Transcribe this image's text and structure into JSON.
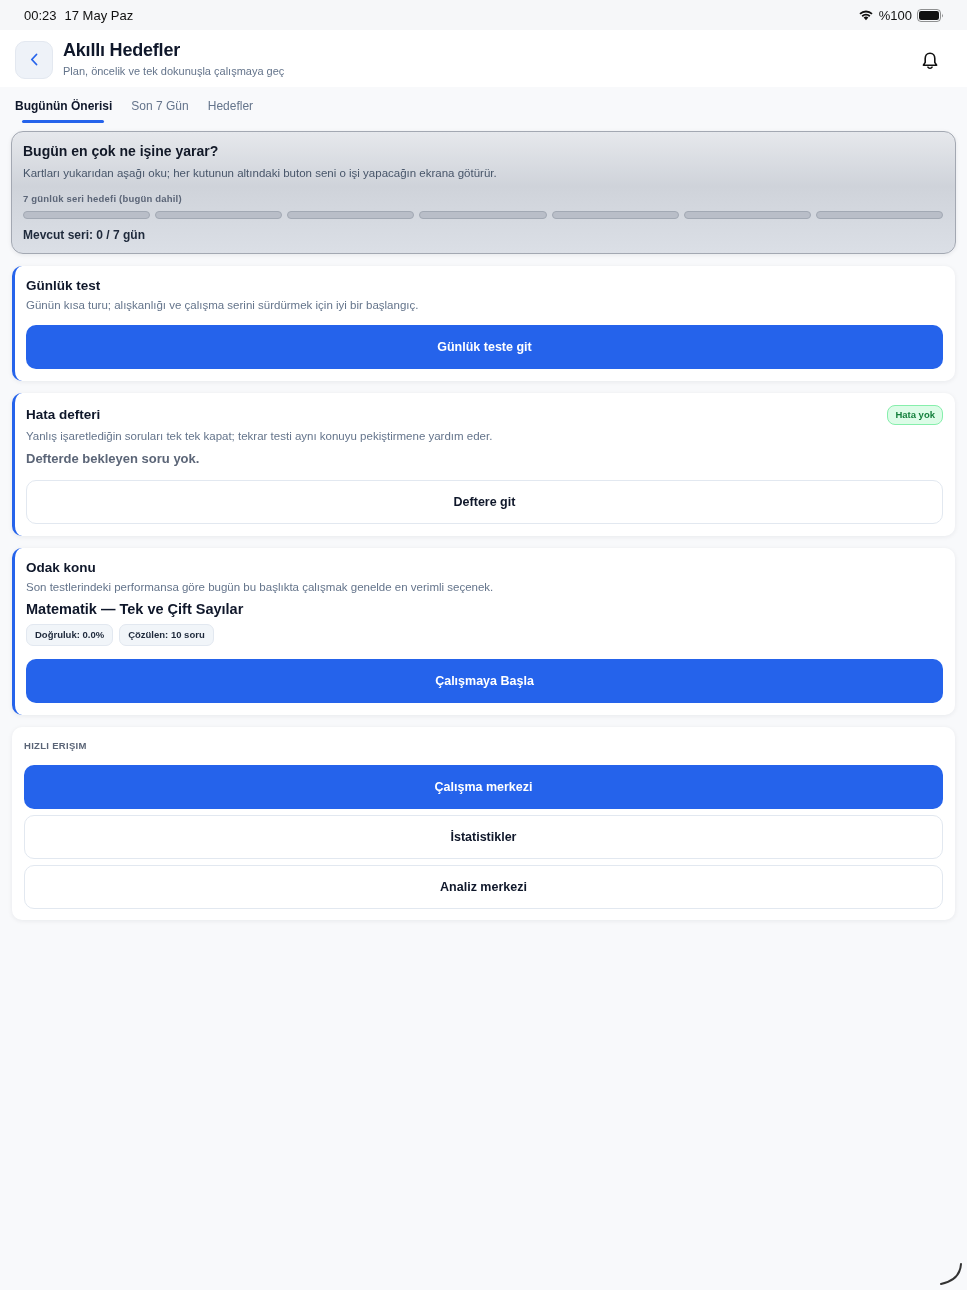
{
  "status_bar": {
    "time": "00:23",
    "date": "17 May Paz",
    "battery": "%100"
  },
  "header": {
    "title": "Akıllı Hedefler",
    "subtitle": "Plan, öncelik ve tek dokunuşla çalışmaya geç"
  },
  "tabs": [
    {
      "label": "Bugünün Önerisi",
      "selected": true
    },
    {
      "label": "Son 7 Gün",
      "selected": false
    },
    {
      "label": "Hedefler",
      "selected": false
    }
  ],
  "hero": {
    "title": "Bugün en çok ne işine yarar?",
    "text": "Kartları yukarıdan aşağı oku; her kutunun altındaki buton seni o işi yapacağın ekrana götürür.",
    "streak_label": "7 günlük seri hedefi (bugün dahil)",
    "streak_days": [
      {
        "done": false
      },
      {
        "done": false
      },
      {
        "done": false
      },
      {
        "done": false
      },
      {
        "done": false
      },
      {
        "done": false
      },
      {
        "done": false
      }
    ],
    "streak_text": "Mevcut seri: 0 / 7 gün"
  },
  "cards": [
    {
      "title": "Günlük test",
      "text": "Günün kısa turu; alışkanlığı ve çalışma serini sürdürmek için iyi bir başlangıç.",
      "button": {
        "label": "Günlük teste git",
        "kind": "primary"
      }
    },
    {
      "title": "Hata defteri",
      "badge": "Hata yok",
      "text": "Yanlış işaretlediğin soruları tek tek kapat; tekrar testi aynı konuyu pekiştirmene yardım eder.",
      "note": "Defterde bekleyen soru yok.",
      "button": {
        "label": "Deftere git",
        "kind": "secondary"
      }
    },
    {
      "title": "Odak konu",
      "text": "Son testlerindeki performansa göre bugün bu başlıkta çalışmak genelde en verimli seçenek.",
      "topic": "Matematik — Tek ve Çift Sayılar",
      "chips": [
        "Doğruluk: 0.0%",
        "Çözülen: 10 soru"
      ],
      "button": {
        "label": "Çalışmaya Başla",
        "kind": "primary"
      }
    }
  ],
  "quick_access": {
    "heading": "HIZLI ERIŞIM",
    "buttons": [
      {
        "label": "Çalışma merkezi",
        "kind": "primary"
      },
      {
        "label": "İstatistikler",
        "kind": "secondary"
      },
      {
        "label": "Analiz merkezi",
        "kind": "secondary"
      }
    ]
  }
}
